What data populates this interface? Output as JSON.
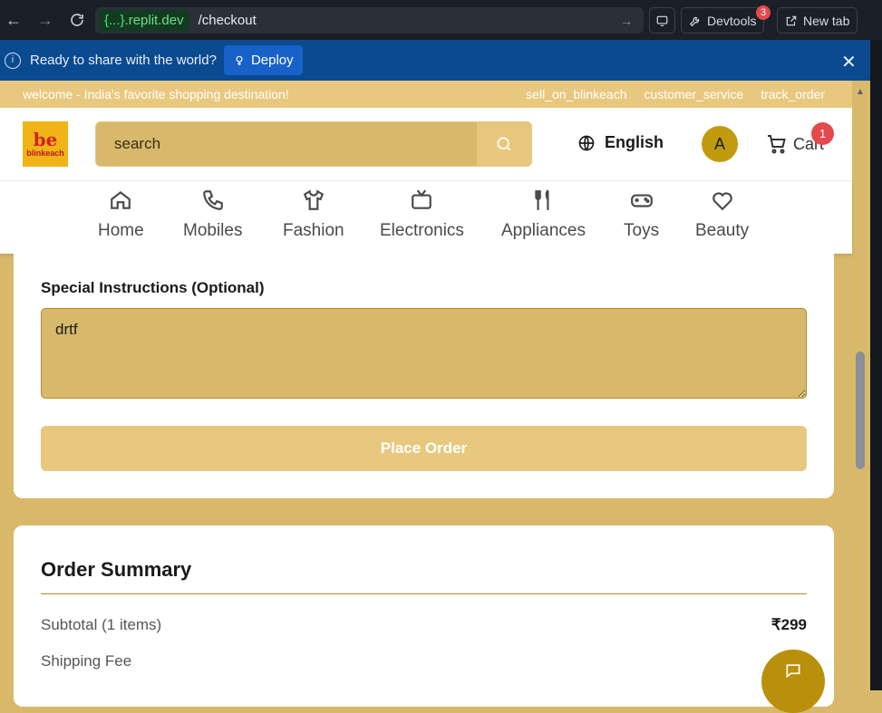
{
  "browser": {
    "url_host_brace": "{...}",
    "url_host": ".replit.dev",
    "url_path": "/checkout",
    "devtools_label": "Devtools",
    "devtools_badge": "3",
    "new_tab_label": "New tab"
  },
  "banner": {
    "message": "Ready to share with the world?",
    "deploy_label": "Deploy"
  },
  "topstrip": {
    "welcome": "welcome - India's favorite shopping destination!",
    "links": [
      "sell_on_blinkeach",
      "customer_service",
      "track_order"
    ]
  },
  "header": {
    "logo_mark": "be",
    "logo_text": "blinkeach",
    "search_placeholder": "search",
    "language": "English",
    "avatar_initial": "A",
    "cart_label": "Cart",
    "cart_count": "1"
  },
  "categories": [
    {
      "label": "Home",
      "icon": "home-icon"
    },
    {
      "label": "Mobiles",
      "icon": "phone-icon"
    },
    {
      "label": "Fashion",
      "icon": "shirt-icon"
    },
    {
      "label": "Electronics",
      "icon": "tv-icon"
    },
    {
      "label": "Appliances",
      "icon": "utensils-icon"
    },
    {
      "label": "Toys",
      "icon": "gamepad-icon"
    },
    {
      "label": "Beauty",
      "icon": "heart-icon"
    }
  ],
  "checkout": {
    "instructions_label": "Special Instructions (Optional)",
    "instructions_value": "drtf",
    "place_order_label": "Place Order"
  },
  "summary": {
    "title": "Order Summary",
    "subtotal_label": "Subtotal (1 items)",
    "subtotal_value": "₹299",
    "shipping_label": "Shipping Fee"
  },
  "colors": {
    "brand_gold": "#d8b96b",
    "accent_light": "#e8c87f",
    "avatar": "#c29a0d",
    "badge_red": "#e5484d",
    "replit_banner": "#0b4a8f"
  }
}
